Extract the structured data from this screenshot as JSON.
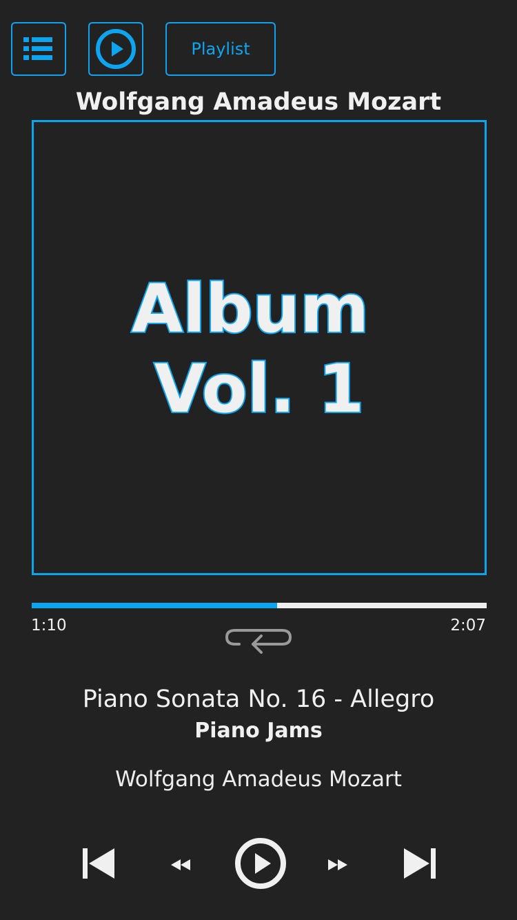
{
  "colors": {
    "background": "#222222",
    "accent": "#0ea5f0",
    "text": "#f0f0f0",
    "track": "#eeeeee",
    "repeat_icon": "#9a9a9a"
  },
  "header": {
    "list_button_icon": "list-icon",
    "play_button_icon": "play-circle-icon",
    "playlist_label": "Playlist"
  },
  "top_artist": "Wolfgang Amadeus Mozart",
  "cover": {
    "line1": "Album",
    "line2": "Vol. 1"
  },
  "progress": {
    "elapsed": "1:10",
    "total": "2:07",
    "fraction": 0.54
  },
  "repeat_icon": "repeat-icon",
  "track": {
    "title": "Piano Sonata No. 16 - Allegro",
    "album": "Piano Jams",
    "artist": "Wolfgang Amadeus Mozart"
  },
  "controls": {
    "prev_icon": "skip-previous-icon",
    "rewind_icon": "rewind-icon",
    "play_icon": "play-circle-icon",
    "forward_icon": "fast-forward-icon",
    "next_icon": "skip-next-icon"
  }
}
